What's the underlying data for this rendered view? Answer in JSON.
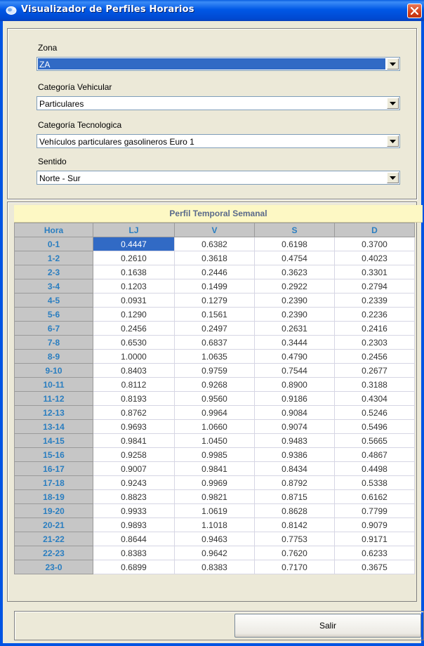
{
  "window": {
    "title": "Visualizador de Perfiles Horarios"
  },
  "filters": {
    "zona": {
      "label": "Zona",
      "value": "ZA"
    },
    "categoria_vehicular": {
      "label": "Categoría Vehicular",
      "value": "Particulares"
    },
    "categoria_tecnologica": {
      "label": "Categoría Tecnologica",
      "value": "Vehículos particulares gasolineros Euro 1"
    },
    "sentido": {
      "label": "Sentido",
      "value": "Norte - Sur"
    }
  },
  "table": {
    "title": "Perfil Temporal Semanal",
    "headers": [
      "Hora",
      "LJ",
      "V",
      "S",
      "D"
    ],
    "rows": [
      {
        "hora": "0-1",
        "lj": "0.4447",
        "v": "0.6382",
        "s": "0.6198",
        "d": "0.3700"
      },
      {
        "hora": "1-2",
        "lj": "0.2610",
        "v": "0.3618",
        "s": "0.4754",
        "d": "0.4023"
      },
      {
        "hora": "2-3",
        "lj": "0.1638",
        "v": "0.2446",
        "s": "0.3623",
        "d": "0.3301"
      },
      {
        "hora": "3-4",
        "lj": "0.1203",
        "v": "0.1499",
        "s": "0.2922",
        "d": "0.2794"
      },
      {
        "hora": "4-5",
        "lj": "0.0931",
        "v": "0.1279",
        "s": "0.2390",
        "d": "0.2339"
      },
      {
        "hora": "5-6",
        "lj": "0.1290",
        "v": "0.1561",
        "s": "0.2390",
        "d": "0.2236"
      },
      {
        "hora": "6-7",
        "lj": "0.2456",
        "v": "0.2497",
        "s": "0.2631",
        "d": "0.2416"
      },
      {
        "hora": "7-8",
        "lj": "0.6530",
        "v": "0.6837",
        "s": "0.3444",
        "d": "0.2303"
      },
      {
        "hora": "8-9",
        "lj": "1.0000",
        "v": "1.0635",
        "s": "0.4790",
        "d": "0.2456"
      },
      {
        "hora": "9-10",
        "lj": "0.8403",
        "v": "0.9759",
        "s": "0.7544",
        "d": "0.2677"
      },
      {
        "hora": "10-11",
        "lj": "0.8112",
        "v": "0.9268",
        "s": "0.8900",
        "d": "0.3188"
      },
      {
        "hora": "11-12",
        "lj": "0.8193",
        "v": "0.9560",
        "s": "0.9186",
        "d": "0.4304"
      },
      {
        "hora": "12-13",
        "lj": "0.8762",
        "v": "0.9964",
        "s": "0.9084",
        "d": "0.5246"
      },
      {
        "hora": "13-14",
        "lj": "0.9693",
        "v": "1.0660",
        "s": "0.9074",
        "d": "0.5496"
      },
      {
        "hora": "14-15",
        "lj": "0.9841",
        "v": "1.0450",
        "s": "0.9483",
        "d": "0.5665"
      },
      {
        "hora": "15-16",
        "lj": "0.9258",
        "v": "0.9985",
        "s": "0.9386",
        "d": "0.4867"
      },
      {
        "hora": "16-17",
        "lj": "0.9007",
        "v": "0.9841",
        "s": "0.8434",
        "d": "0.4498"
      },
      {
        "hora": "17-18",
        "lj": "0.9243",
        "v": "0.9969",
        "s": "0.8792",
        "d": "0.5338"
      },
      {
        "hora": "18-19",
        "lj": "0.8823",
        "v": "0.9821",
        "s": "0.8715",
        "d": "0.6162"
      },
      {
        "hora": "19-20",
        "lj": "0.9933",
        "v": "1.0619",
        "s": "0.8628",
        "d": "0.7799"
      },
      {
        "hora": "20-21",
        "lj": "0.9893",
        "v": "1.1018",
        "s": "0.8142",
        "d": "0.9079"
      },
      {
        "hora": "21-22",
        "lj": "0.8644",
        "v": "0.9463",
        "s": "0.7753",
        "d": "0.9171"
      },
      {
        "hora": "22-23",
        "lj": "0.8383",
        "v": "0.9642",
        "s": "0.7620",
        "d": "0.6233"
      },
      {
        "hora": "23-0",
        "lj": "0.6899",
        "v": "0.8383",
        "s": "0.7170",
        "d": "0.3675"
      }
    ]
  },
  "buttons": {
    "salir": "Salir"
  },
  "colors": {
    "titlebar": "#0054e3",
    "selection": "#316ac5",
    "header_text": "#2a7ec0",
    "table_title_bg": "#fdf8c4"
  },
  "icons": {
    "app": "app-icon",
    "close": "close-icon",
    "dropdown": "chevron-down-icon"
  }
}
